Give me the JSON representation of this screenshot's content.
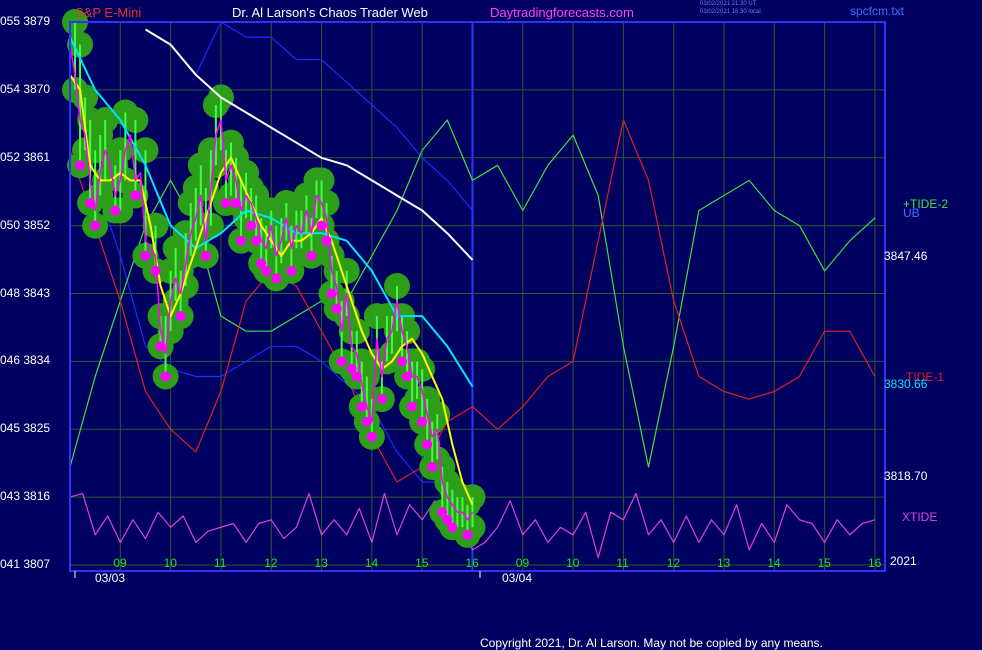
{
  "header": {
    "title_left": "S&P E-Mini",
    "title_mid": "Dr. Al Larson's Chaos Trader Web",
    "website": "Daytradingforecasts.com",
    "stamp_line1": "03/02/2021 21:30 UT",
    "stamp_line2": "03/02/2021 16:30 local",
    "source_file": "spcfcm.txt",
    "copyright": "Copyright 2021, Dr. Al Larson. May not be copied by any means."
  },
  "colors": {
    "background": "#000060",
    "grid": "#2e5a2e",
    "frame": "#3030ff",
    "price": "#ff00ff",
    "ma_fast": "#ffff00",
    "ma_mid": "#00e5ff",
    "ma_slow": "#ffffff",
    "band": "#1a2cff",
    "tide1": "#e02020",
    "tide2": "#40e040",
    "xtide": "#e040e0",
    "bubble": "#2d9e1a",
    "volume": "#40ff40"
  },
  "chart_data": {
    "type": "line",
    "instrument": "S&P E-Mini",
    "ylim": [
      3807,
      3879
    ],
    "y_ticks": [
      {
        "code": "055",
        "price": "3879"
      },
      {
        "code": "054",
        "price": "3870"
      },
      {
        "code": "052",
        "price": "3861"
      },
      {
        "code": "050",
        "price": "3852"
      },
      {
        "code": "048",
        "price": "3843"
      },
      {
        "code": "046",
        "price": "3834"
      },
      {
        "code": "045",
        "price": "3825"
      },
      {
        "code": "043",
        "price": "3816"
      },
      {
        "code": "041",
        "price": "3807"
      }
    ],
    "x_range": [
      8.0,
      24.2
    ],
    "x_ticks": [
      "09",
      "10",
      "11",
      "12",
      "13",
      "14",
      "15",
      "16",
      "09",
      "10",
      "11",
      "12",
      "13",
      "14",
      "15",
      "16"
    ],
    "date_labels": [
      "03/03",
      "03/04"
    ],
    "right_labels": {
      "tide2": "+TIDE-2",
      "ub": "UB",
      "lb_value": "3847.46",
      "tide1": "TIDE-1",
      "ma_value": "3830.66",
      "low_value": "3818.70",
      "xtide": "XTIDE",
      "year": "2021"
    },
    "series": [
      {
        "key": "price",
        "x": [
          8.0,
          8.1,
          8.2,
          8.3,
          8.4,
          8.5,
          8.6,
          8.7,
          8.8,
          8.9,
          9.0,
          9.1,
          9.2,
          9.3,
          9.4,
          9.5,
          9.6,
          9.7,
          9.8,
          9.9,
          10.0,
          10.1,
          10.2,
          10.3,
          10.4,
          10.5,
          10.6,
          10.7,
          10.8,
          10.9,
          11.0,
          11.1,
          11.2,
          11.3,
          11.4,
          11.5,
          11.6,
          11.7,
          11.8,
          11.9,
          12.0,
          12.1,
          12.2,
          12.3,
          12.4,
          12.5,
          12.6,
          12.7,
          12.8,
          12.9,
          13.0,
          13.1,
          13.2,
          13.3,
          13.4,
          13.5,
          13.6,
          13.7,
          13.8,
          13.9,
          14.0,
          14.1,
          14.2,
          14.3,
          14.4,
          14.5,
          14.6,
          14.7,
          14.8,
          14.9,
          15.0,
          15.1,
          15.2,
          15.3,
          15.4,
          15.5,
          15.6,
          15.7,
          15.8,
          15.9,
          16.0
        ],
        "y": [
          3876,
          3872,
          3866,
          3864,
          3858,
          3854,
          3859,
          3862,
          3860,
          3856,
          3858,
          3862,
          3864,
          3858,
          3859,
          3850,
          3849,
          3848,
          3838,
          3835,
          3842,
          3845,
          3843,
          3847,
          3851,
          3853,
          3856,
          3850,
          3857,
          3864,
          3866,
          3858,
          3860,
          3858,
          3854,
          3856,
          3855,
          3853,
          3850,
          3849,
          3852,
          3848,
          3850,
          3853,
          3849,
          3852,
          3851,
          3854,
          3851,
          3856,
          3855,
          3853,
          3846,
          3844,
          3838,
          3843,
          3836,
          3835,
          3831,
          3828,
          3826,
          3837,
          3832,
          3837,
          3838,
          3842,
          3838,
          3836,
          3832,
          3832,
          3830,
          3827,
          3824,
          3825,
          3818,
          3816,
          3815,
          3814,
          3814,
          3813,
          3814
        ]
      },
      {
        "key": "ma_fast",
        "x": [
          8.0,
          8.2,
          8.4,
          8.6,
          8.8,
          9.0,
          9.2,
          9.4,
          9.6,
          9.8,
          10.0,
          10.2,
          10.4,
          10.6,
          10.8,
          11.0,
          11.2,
          11.4,
          11.6,
          11.8,
          12.0,
          12.2,
          12.4,
          12.6,
          12.8,
          13.0,
          13.2,
          13.4,
          13.6,
          13.8,
          14.0,
          14.2,
          14.4,
          14.6,
          14.8,
          15.0,
          15.2,
          15.4,
          15.6,
          15.8,
          16.0
        ],
        "y": [
          3872,
          3870,
          3860,
          3858,
          3858,
          3859,
          3858,
          3858,
          3852,
          3844,
          3840,
          3843,
          3847,
          3851,
          3855,
          3859,
          3861,
          3858,
          3855,
          3852,
          3850,
          3848,
          3850,
          3850,
          3851,
          3853,
          3850,
          3846,
          3842,
          3838,
          3835,
          3833,
          3834,
          3836,
          3837,
          3835,
          3832,
          3829,
          3823,
          3818,
          3815
        ]
      },
      {
        "key": "ma_mid",
        "x": [
          8.0,
          8.5,
          9.0,
          9.5,
          10.0,
          10.5,
          11.0,
          11.5,
          12.0,
          12.5,
          13.0,
          13.5,
          14.0,
          14.5,
          15.0,
          15.5,
          16.0
        ],
        "y": [
          3877,
          3870,
          3866,
          3860,
          3852,
          3849,
          3851,
          3854,
          3853,
          3851,
          3851,
          3850,
          3846,
          3840,
          3840,
          3836,
          3830.66
        ]
      },
      {
        "key": "ma_slow",
        "x": [
          9.5,
          10.0,
          10.5,
          11.0,
          11.5,
          12.0,
          12.5,
          13.0,
          13.5,
          14.0,
          14.5,
          15.0,
          15.5,
          16.0
        ],
        "y": [
          3878,
          3876,
          3872,
          3869,
          3867,
          3865,
          3863,
          3861,
          3860,
          3858,
          3856,
          3854,
          3851,
          3847.46
        ]
      },
      {
        "key": "band_upper",
        "x": [
          10.5,
          11.0,
          11.5,
          12.0,
          12.5,
          13.0,
          13.5,
          14.0,
          14.5,
          15.0,
          15.5,
          16.0
        ],
        "y": [
          3872,
          3879,
          3877,
          3877,
          3874,
          3874,
          3871,
          3868,
          3865,
          3861,
          3858,
          3854
        ]
      },
      {
        "key": "band_lower",
        "x": [
          8.5,
          9.0,
          9.5,
          10.0,
          10.5,
          11.0,
          11.5,
          12.0,
          12.5,
          13.0,
          13.5,
          14.0,
          14.5,
          15.0,
          15.5,
          16.0
        ],
        "y": [
          3858,
          3848,
          3836,
          3833,
          3832,
          3832,
          3834,
          3836,
          3836,
          3834,
          3831,
          3828,
          3822,
          3818,
          3818,
          3816
        ]
      },
      {
        "key": "tide2",
        "x": [
          8.0,
          8.5,
          9.0,
          9.5,
          10.0,
          10.5,
          11.0,
          11.5,
          12.0,
          12.5,
          13.0,
          13.5,
          14.0,
          14.5,
          15.0,
          15.5,
          16.0,
          16.5,
          17.0,
          17.5,
          18.0,
          18.5,
          19.0,
          19.5,
          20.0,
          20.5,
          21.0,
          21.5,
          22.0,
          22.5,
          23.0,
          23.5,
          24.0
        ],
        "y": [
          3820,
          3832,
          3842,
          3852,
          3858,
          3852,
          3840,
          3838,
          3838,
          3840,
          3842,
          3842,
          3848,
          3854,
          3862,
          3866,
          3858,
          3860,
          3854,
          3860,
          3864,
          3856,
          3836,
          3820,
          3836,
          3854,
          3856,
          3858,
          3854,
          3852,
          3846,
          3850,
          3853
        ]
      },
      {
        "key": "tide1",
        "x": [
          8.0,
          8.5,
          9.0,
          9.5,
          10.0,
          10.5,
          11.0,
          11.5,
          12.0,
          12.5,
          13.0,
          13.5,
          14.0,
          14.5,
          15.0,
          15.5,
          16.0,
          16.5,
          17.0,
          17.5,
          18.0,
          18.5,
          19.0,
          19.5,
          20.0,
          20.5,
          21.0,
          21.5,
          22.0,
          22.5,
          23.0,
          23.5,
          24.0
        ],
        "y": [
          3862,
          3852,
          3842,
          3830,
          3825,
          3822,
          3830,
          3842,
          3846,
          3844,
          3838,
          3832,
          3824,
          3818,
          3820,
          3826,
          3828,
          3825,
          3828,
          3832,
          3834,
          3850,
          3866,
          3858,
          3842,
          3832,
          3830,
          3829,
          3830,
          3832,
          3838,
          3838,
          3832
        ]
      },
      {
        "key": "xtide",
        "x": [
          8.0,
          8.25,
          8.5,
          8.75,
          9.0,
          9.25,
          9.5,
          9.75,
          10.0,
          10.25,
          10.5,
          10.75,
          11.0,
          11.25,
          11.5,
          11.75,
          12.0,
          12.25,
          12.5,
          12.75,
          13.0,
          13.25,
          13.5,
          13.75,
          14.0,
          14.25,
          14.5,
          14.75,
          15.0,
          15.25,
          15.5,
          15.75,
          16.0,
          16.25,
          16.5,
          16.75,
          17.0,
          17.25,
          17.5,
          17.75,
          18.0,
          18.25,
          18.5,
          18.75,
          19.0,
          19.25,
          19.5,
          19.75,
          20.0,
          20.25,
          20.5,
          20.75,
          21.0,
          21.25,
          21.5,
          21.75,
          22.0,
          22.25,
          22.5,
          22.75,
          23.0,
          23.25,
          23.5,
          23.75,
          24.0
        ],
        "y": [
          3816,
          3816.5,
          3811,
          3813.5,
          3810,
          3813,
          3810.5,
          3814,
          3812,
          3813.5,
          3810,
          3811.5,
          3812,
          3812.5,
          3810,
          3812.5,
          3813,
          3810.5,
          3812,
          3816.5,
          3811,
          3813,
          3811,
          3814.5,
          3810,
          3816.5,
          3811,
          3815,
          3813,
          3815.5,
          3811,
          3812,
          3809,
          3810,
          3812,
          3815.5,
          3811,
          3813,
          3810,
          3812,
          3811,
          3814,
          3808,
          3814,
          3813,
          3816.5,
          3811,
          3813,
          3810,
          3813.5,
          3810,
          3813,
          3811,
          3815,
          3809,
          3812.5,
          3810,
          3815,
          3813,
          3812.5,
          3810,
          3813,
          3811,
          3812.5,
          3813
        ]
      }
    ],
    "highs_lows": {
      "x": [
        8.1,
        8.2,
        8.3,
        8.4,
        8.5,
        8.6,
        8.7,
        8.9,
        9.0,
        9.1,
        9.3,
        9.5,
        9.7,
        9.8,
        9.9,
        10.0,
        10.1,
        10.2,
        10.3,
        10.4,
        10.5,
        10.6,
        10.7,
        10.8,
        10.9,
        11.0,
        11.1,
        11.2,
        11.3,
        11.4,
        11.5,
        11.6,
        11.7,
        11.8,
        11.9,
        12.0,
        12.1,
        12.2,
        12.3,
        12.4,
        12.5,
        12.6,
        12.7,
        12.8,
        12.9,
        13.0,
        13.1,
        13.2,
        13.3,
        13.4,
        13.5,
        13.6,
        13.7,
        13.8,
        13.9,
        14.0,
        14.1,
        14.2,
        14.3,
        14.4,
        14.5,
        14.6,
        14.7,
        14.8,
        14.9,
        15.0,
        15.1,
        15.2,
        15.3,
        15.4,
        15.5,
        15.6,
        15.7,
        15.8,
        15.9,
        16.0
      ],
      "high": [
        3879,
        3876,
        3869,
        3866,
        3862,
        3864,
        3866,
        3860,
        3862,
        3867,
        3866,
        3862,
        3852,
        3840,
        3840,
        3846,
        3849,
        3846,
        3851,
        3855,
        3857,
        3860,
        3857,
        3862,
        3868,
        3869,
        3862,
        3863,
        3861,
        3858,
        3859,
        3857,
        3856,
        3853,
        3852,
        3854,
        3852,
        3853,
        3855,
        3852,
        3854,
        3854,
        3856,
        3853,
        3858,
        3858,
        3855,
        3848,
        3846,
        3842,
        3846,
        3838,
        3838,
        3834,
        3832,
        3829,
        3840,
        3834,
        3840,
        3840,
        3844,
        3840,
        3838,
        3834,
        3834,
        3833,
        3829,
        3826,
        3827,
        3820,
        3818,
        3817,
        3816,
        3816,
        3815,
        3816
      ],
      "low": [
        3870,
        3860,
        3862,
        3855,
        3852,
        3856,
        3858,
        3854,
        3854,
        3858,
        3856,
        3848,
        3846,
        3836,
        3832,
        3838,
        3842,
        3840,
        3844,
        3848,
        3850,
        3852,
        3848,
        3852,
        3860,
        3862,
        3855,
        3856,
        3855,
        3850,
        3853,
        3852,
        3850,
        3847,
        3846,
        3849,
        3845,
        3847,
        3850,
        3846,
        3849,
        3849,
        3851,
        3848,
        3853,
        3852,
        3850,
        3843,
        3841,
        3834,
        3840,
        3833,
        3832,
        3828,
        3826,
        3824,
        3834,
        3829,
        3834,
        3835,
        3838,
        3834,
        3832,
        3828,
        3829,
        3826,
        3823,
        3820,
        3821,
        3814,
        3813,
        3812,
        3812,
        3812,
        3811,
        3812
      ]
    }
  }
}
